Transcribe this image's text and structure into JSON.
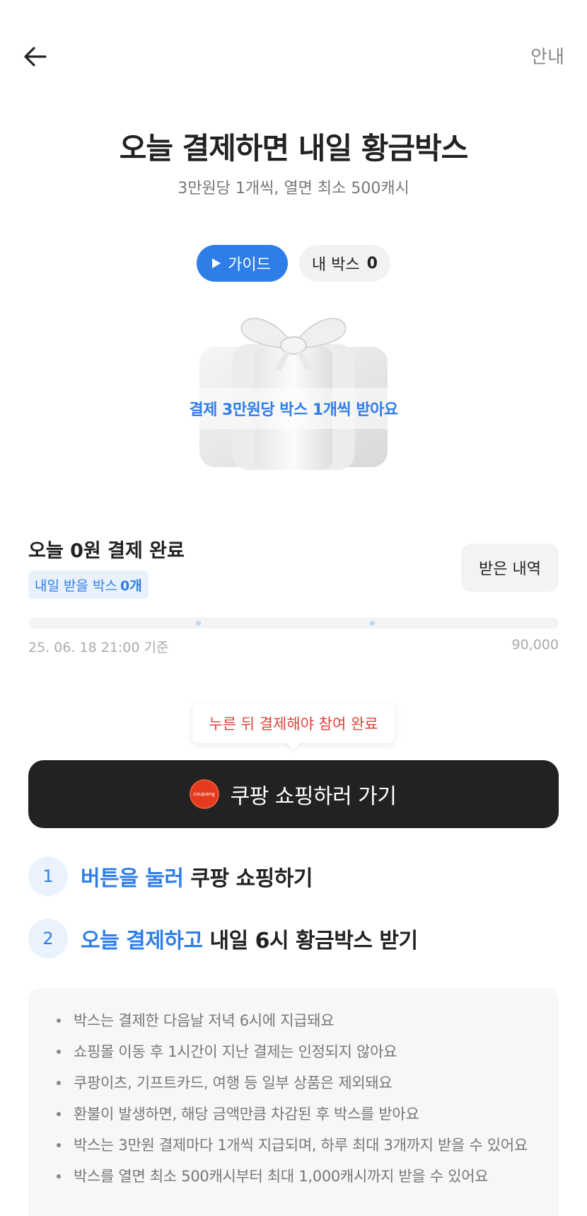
{
  "header": {
    "info_label": "안내"
  },
  "hero": {
    "title": "오늘 결제하면 내일 황금박스",
    "subtitle": "3만원당 1개씩, 열면 최소 500캐시"
  },
  "chips": {
    "guide_label": "가이드",
    "mybox_label": "내 박스",
    "mybox_count": "0"
  },
  "gift": {
    "caption": "결제 3만원당 박스 1개씩 받아요"
  },
  "status": {
    "today_title": "오늘 0원 결제 완료",
    "tomorrow_label": "내일 받을 박스",
    "tomorrow_count": "0개",
    "history_label": "받은 내역",
    "progress_fraction": 0,
    "progress_left": "25. 06. 18 21:00 기준",
    "progress_right": "90,000",
    "accent_color": "#2f7ee8"
  },
  "cta": {
    "tooltip": "누른 뒤 결제해야 참여 완료",
    "logo_text": "coupang",
    "button_label": "쿠팡 쇼핑하러 가기"
  },
  "steps": [
    {
      "num": "1",
      "highlight": "버튼을 눌러",
      "rest": " 쿠팡 쇼핑하기"
    },
    {
      "num": "2",
      "highlight": "오늘 결제하고",
      "rest": " 내일 6시 황금박스 받기"
    }
  ],
  "notices": [
    "박스는 결제한 다음날 저녁 6시에 지급돼요",
    "쇼핑몰 이동 후 1시간이 지난 결제는 인정되지 않아요",
    "쿠팡이츠, 기프트카드, 여행 등 일부 상품은 제외돼요",
    "환불이 발생하면, 해당 금액만큼 차감된 후 박스를 받아요",
    "박스는 3만원 결제마다 1개씩 지급되며, 하루 최대 3개까지 받을 수 있어요",
    "박스를 열면 최소 500캐시부터 최대 1,000캐시까지 받을 수 있어요"
  ]
}
